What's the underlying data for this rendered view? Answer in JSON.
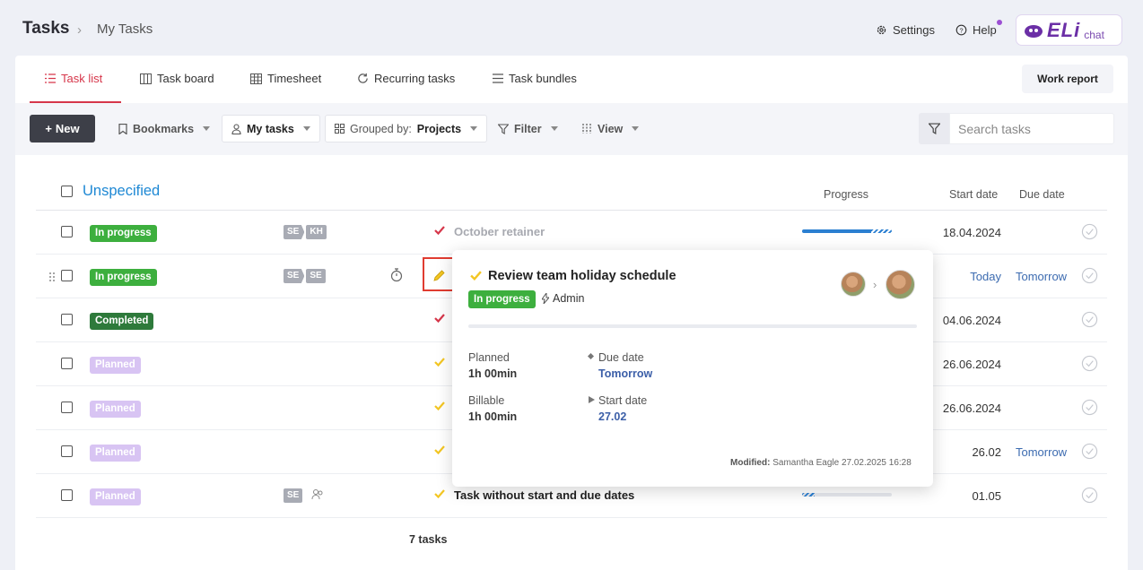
{
  "header": {
    "title": "Tasks",
    "breadcrumb_sep": "›",
    "breadcrumb": "My Tasks",
    "settings": "Settings",
    "help": "Help",
    "eli_logo": "ELi",
    "eli_chat": "chat"
  },
  "tabs": {
    "task_list": "Task list",
    "task_board": "Task board",
    "timesheet": "Timesheet",
    "recurring": "Recurring tasks",
    "bundles": "Task bundles",
    "work_report": "Work report"
  },
  "toolbar": {
    "new": "New",
    "new_plus": "+",
    "bookmarks": "Bookmarks",
    "my_tasks": "My tasks",
    "grouped_prefix": "Grouped by:",
    "grouped_value": "Projects",
    "filter": "Filter",
    "view": "View",
    "search_placeholder": "Search tasks"
  },
  "group": {
    "title": "Unspecified",
    "col_progress": "Progress",
    "col_start": "Start date",
    "col_due": "Due date",
    "footer": "7 tasks"
  },
  "rows": [
    {
      "status": "In progress",
      "tags": [
        "SE",
        "KH"
      ],
      "name": "October retainer",
      "start": "18.04.2024",
      "due": ""
    },
    {
      "status": "In progress",
      "tags": [
        "SE",
        "SE"
      ],
      "name": "",
      "start": "Today",
      "due": "Tomorrow"
    },
    {
      "status": "Completed",
      "tags": [],
      "name": "",
      "start": "04.06.2024",
      "due": ""
    },
    {
      "status": "Planned",
      "tags": [],
      "name": "",
      "start": "26.06.2024",
      "due": ""
    },
    {
      "status": "Planned",
      "tags": [],
      "name": "",
      "start": "26.06.2024",
      "due": ""
    },
    {
      "status": "Planned",
      "tags": [],
      "name": "",
      "start": "26.02",
      "due": "Tomorrow"
    },
    {
      "status": "Planned",
      "tags": [
        "SE"
      ],
      "name": "Task without start and due dates",
      "start": "01.05",
      "due": ""
    }
  ],
  "popup": {
    "title": "Review team holiday schedule",
    "status": "In progress",
    "owner": "Admin",
    "planned_label": "Planned",
    "planned_value": "1h 00min",
    "billable_label": "Billable",
    "billable_value": "1h 00min",
    "due_label": "Due date",
    "due_value": "Tomorrow",
    "start_label": "Start date",
    "start_value": "27.02",
    "modified_label": "Modified:",
    "modified_value": "Samantha Eagle 27.02.2025 16:28"
  },
  "colors": {
    "accent_red": "#d6364a",
    "link_blue": "#1e88d4",
    "status_in_progress": "#3daf3e",
    "status_completed": "#2e7a3b",
    "status_planned": "#d8c4f3"
  }
}
